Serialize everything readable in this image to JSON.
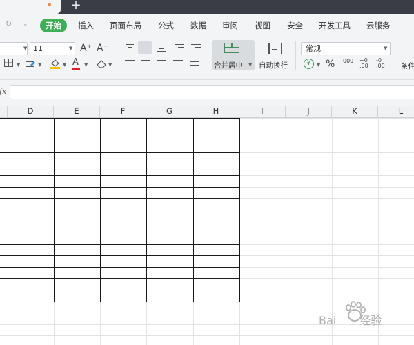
{
  "title_bar": {
    "new_tab_icon": "plus-icon",
    "unsaved_indicator_color": "#f28b3d"
  },
  "menu": {
    "items": [
      {
        "label": "开始",
        "active": true
      },
      {
        "label": "插入"
      },
      {
        "label": "页面布局"
      },
      {
        "label": "公式"
      },
      {
        "label": "数据"
      },
      {
        "label": "审阅"
      },
      {
        "label": "视图"
      },
      {
        "label": "安全"
      },
      {
        "label": "开发工具"
      },
      {
        "label": "云服务"
      }
    ],
    "active_color": "#3db055"
  },
  "toolbar": {
    "font_size": "11",
    "grow_font": "A⁺",
    "shrink_font": "A⁻",
    "merge_label": "合并居中",
    "wrap_label": "自动换行",
    "number_format": "常规",
    "currency_symbol": "¥",
    "percent_symbol": "%",
    "thousands": "000",
    "inc_decimal": "+0 .00",
    "dec_decimal": "-0 .00",
    "conditional_label": "条件"
  },
  "formula_bar": {
    "fx_label": "fx",
    "value": ""
  },
  "sheet": {
    "columns": [
      "D",
      "E",
      "F",
      "G",
      "H",
      "I",
      "J",
      "K",
      "L"
    ],
    "bordered_range": "D:H",
    "bordered_rows": 16
  },
  "watermark": {
    "text_left": "Bai",
    "text_right": "经验"
  }
}
